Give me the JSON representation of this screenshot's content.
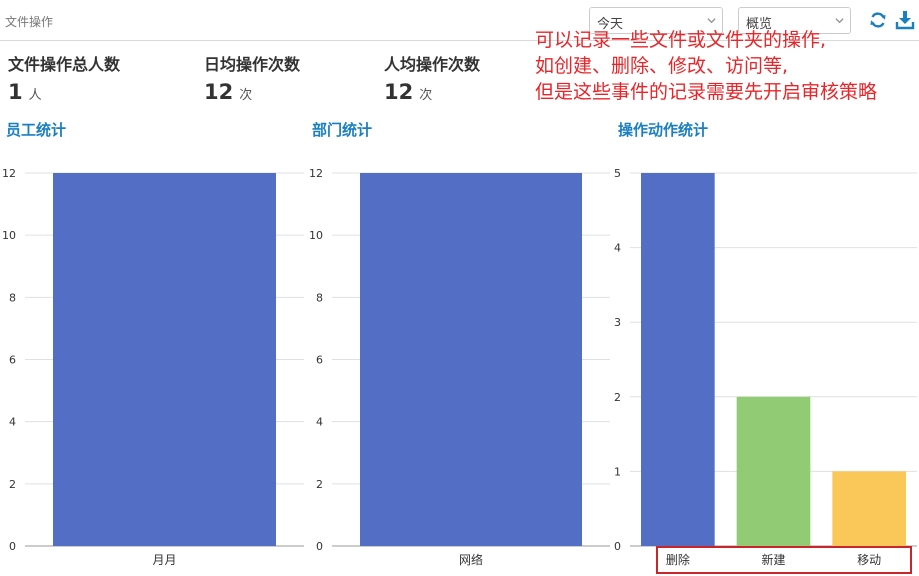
{
  "header": {
    "title": "文件操作",
    "period_select": "今天",
    "mode_select": "概览",
    "refresh_icon": "refresh-icon",
    "download_icon": "download-icon"
  },
  "annotation": {
    "lines": [
      "可以记录一些文件或文件夹的操作,",
      "如创建、删除、修改、访问等,",
      "但是这些事件的记录需要先开启审核策略"
    ],
    "color": "#e8262a"
  },
  "stats": [
    {
      "label": "文件操作总人数",
      "value": "1",
      "unit": "人"
    },
    {
      "label": "日均操作次数",
      "value": "12",
      "unit": "次"
    },
    {
      "label": "人均操作次数",
      "value": "12",
      "unit": "次"
    }
  ],
  "sections": {
    "employee": "员工统计",
    "department": "部门统计",
    "action": "操作动作统计"
  },
  "chart_data": [
    {
      "type": "bar",
      "title": "员工统计",
      "categories": [
        "月月"
      ],
      "values": [
        12
      ],
      "ylim": [
        0,
        12
      ],
      "yticks": [
        "0",
        "2",
        "4",
        "6",
        "8",
        "10",
        "12"
      ],
      "colors": [
        "#526fc5"
      ],
      "grid": true
    },
    {
      "type": "bar",
      "title": "部门统计",
      "categories": [
        "网络"
      ],
      "values": [
        12
      ],
      "ylim": [
        0,
        12
      ],
      "yticks": [
        "0",
        "2",
        "4",
        "6",
        "8",
        "10",
        "12"
      ],
      "colors": [
        "#526fc5"
      ],
      "grid": true
    },
    {
      "type": "bar",
      "title": "操作动作统计",
      "categories": [
        "删除",
        "新建",
        "移动"
      ],
      "values": [
        5,
        2,
        1
      ],
      "ylim": [
        0,
        5
      ],
      "yticks": [
        "0",
        "1",
        "2",
        "3",
        "4",
        "5"
      ],
      "colors": [
        "#526fc5",
        "#91cc75",
        "#fac858"
      ],
      "grid": true
    }
  ]
}
